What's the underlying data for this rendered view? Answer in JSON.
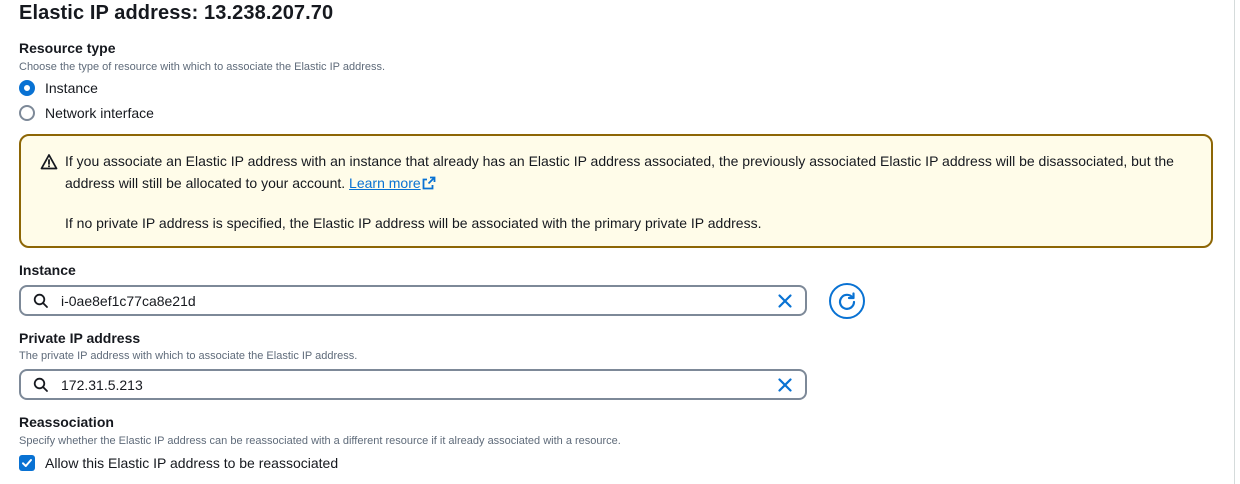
{
  "header": {
    "title": "Elastic IP address: 13.238.207.70"
  },
  "resource_type": {
    "label": "Resource type",
    "description": "Choose the type of resource with which to associate the Elastic IP address.",
    "options": [
      {
        "label": "Instance",
        "selected": true
      },
      {
        "label": "Network interface",
        "selected": false
      }
    ]
  },
  "alert": {
    "line1_text": "If you associate an Elastic IP address with an instance that already has an Elastic IP address associated, the previously associated Elastic IP address will be disassociated, but the address will still be allocated to your account.",
    "learn_more": "Learn more",
    "line2_text": "If no private IP address is specified, the Elastic IP address will be associated with the primary private IP address.",
    "border_color": "#8d6605",
    "background": "#fffce9"
  },
  "instance": {
    "label": "Instance",
    "value": "i-0ae8ef1c77ca8e21d"
  },
  "private_ip": {
    "label": "Private IP address",
    "description": "The private IP address with which to associate the Elastic IP address.",
    "value": "172.31.5.213"
  },
  "reassociation": {
    "label": "Reassociation",
    "description": "Specify whether the Elastic IP address can be reassociated with a different resource if it already associated with a resource.",
    "checkbox_label": "Allow this Elastic IP address to be reassociated",
    "checked": true
  },
  "icons": {
    "warning": "warning-icon",
    "external_link": "external-link-icon",
    "search": "search-icon",
    "clear": "close-icon",
    "refresh": "refresh-icon",
    "check": "checkmark-icon"
  },
  "colors": {
    "accent": "#0972d3",
    "text": "#16191f",
    "muted": "#5f6b7a"
  }
}
